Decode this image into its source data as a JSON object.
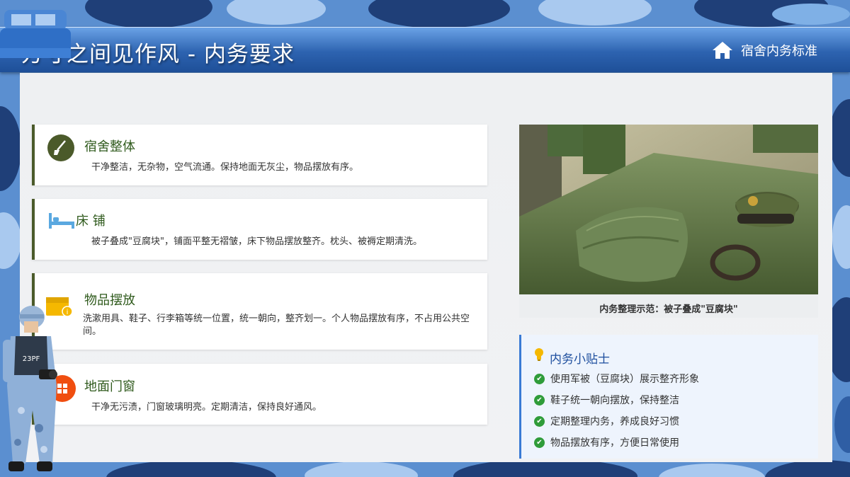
{
  "header": {
    "title": "方寸之间见作风 - 内务要求",
    "nav_label": "宿舍内务标准"
  },
  "cards": [
    {
      "title": "宿舍整体",
      "desc": "干净整洁，无杂物，空气流通。保持地面无灰尘，物品摆放有序。",
      "icon": "broom-icon"
    },
    {
      "title": "床 铺",
      "desc": "被子叠成\"豆腐块\"，铺面平整无褶皱，床下物品摆放整齐。枕头、被褥定期清洗。",
      "icon": "bed-icon"
    },
    {
      "title": "物品摆放",
      "desc": "洗漱用具、鞋子、行李箱等统一位置，统一朝向，整齐划一。个人物品摆放有序，不占用公共空间。",
      "icon": "box-icon"
    },
    {
      "title": "地面门窗",
      "desc": "干净无污渍，门窗玻璃明亮。定期清洁，保持良好通风。",
      "icon": "window-icon"
    }
  ],
  "photo": {
    "caption": "内务整理示范：被子叠成\"豆腐块\""
  },
  "tips": {
    "title": "内务小贴士",
    "items": [
      "使用军被（豆腐块）展示整齐形象",
      "鞋子统一朝向摆放，保持整洁",
      "定期整理内务，养成良好习惯",
      "物品摆放有序，方便日常使用"
    ]
  },
  "colors": {
    "header_blue": "#2d63b0",
    "card_accent": "#4b5a2a",
    "title_green": "#2f5a1c",
    "tips_blue": "#1d4e9e",
    "check_green": "#2f9c3a"
  }
}
